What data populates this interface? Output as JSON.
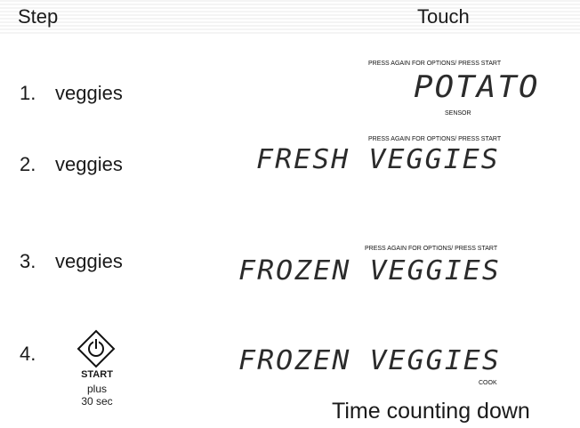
{
  "header": {
    "step": "Step",
    "touch": "Touch"
  },
  "options_label": "PRESS AGAIN FOR OPTIONS/  PRESS START",
  "steps": [
    {
      "num": "1.",
      "text": "veggies",
      "display": "POTATO",
      "sub": "SENSOR"
    },
    {
      "num": "2.",
      "text": "veggies",
      "display": "FRESH VEGGIES"
    },
    {
      "num": "3.",
      "text": "veggies",
      "display": "FROZEN VEGGIES"
    },
    {
      "num": "4.",
      "start_label": "START",
      "plus": "plus",
      "sec": "30 sec",
      "display": "FROZEN VEGGIES",
      "sub": "COOK"
    }
  ],
  "footer": "Time counting down"
}
